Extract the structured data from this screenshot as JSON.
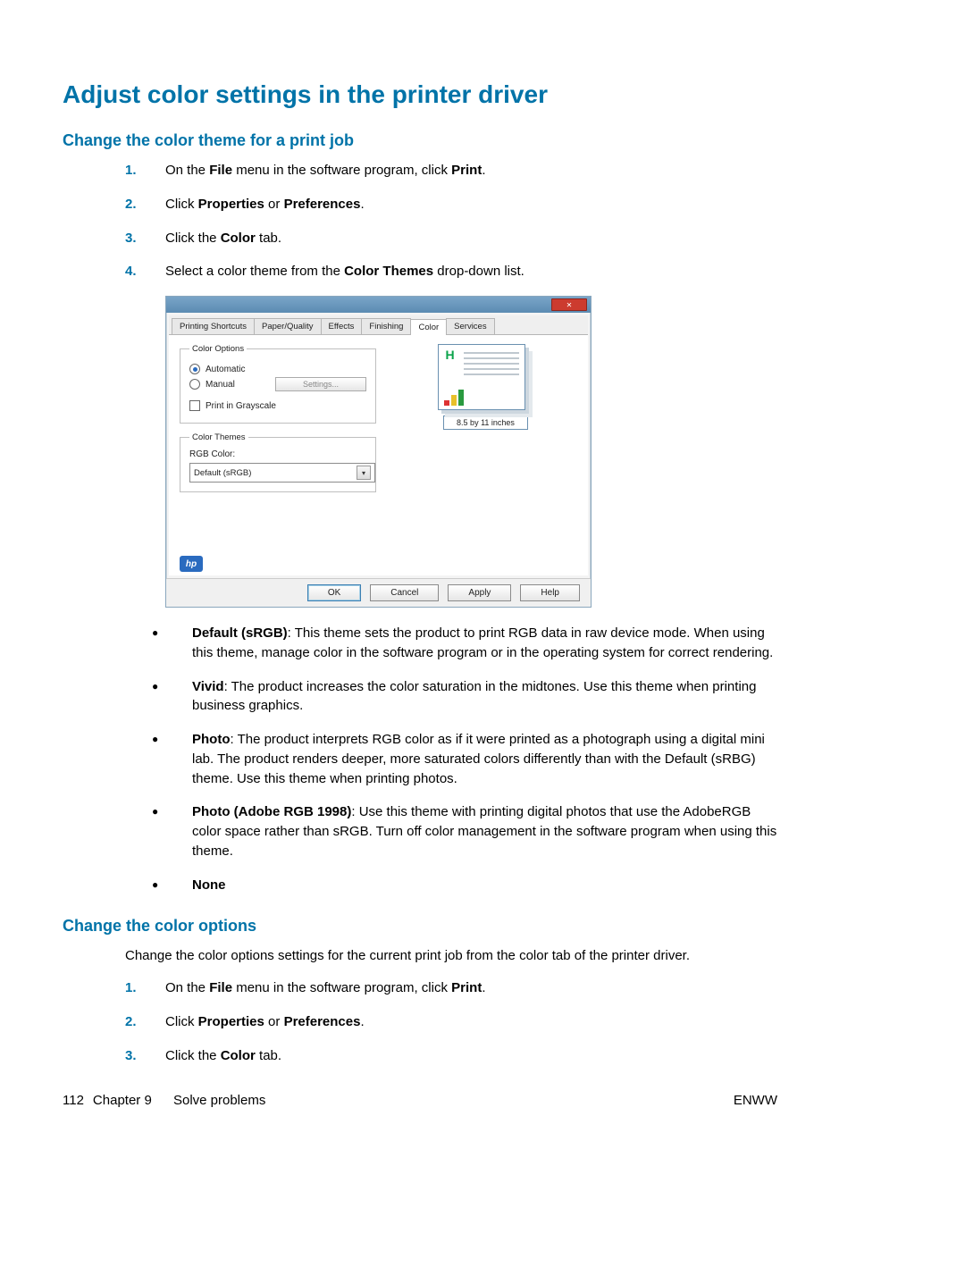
{
  "heading_main": "Adjust color settings in the printer driver",
  "section_a": {
    "heading": "Change the color theme for a print job",
    "steps": [
      {
        "pre": "On the ",
        "b1": "File",
        "mid": " menu in the software program, click ",
        "b2": "Print",
        "post": "."
      },
      {
        "pre": "Click ",
        "b1": "Properties",
        "mid": " or ",
        "b2": "Preferences",
        "post": "."
      },
      {
        "pre": "Click the ",
        "b1": "Color",
        "mid": " tab.",
        "b2": "",
        "post": ""
      },
      {
        "pre": "Select a color theme from the ",
        "b1": "Color Themes",
        "mid": " drop-down list.",
        "b2": "",
        "post": ""
      }
    ],
    "bullets": [
      {
        "b": "Default (sRGB)",
        "t": ": This theme sets the product to print RGB data in raw device mode. When using this theme, manage color in the software program or in the operating system for correct rendering."
      },
      {
        "b": "Vivid",
        "t": ": The product increases the color saturation in the midtones. Use this theme when printing business graphics."
      },
      {
        "b": "Photo",
        "t": ": The product interprets RGB color as if it were printed as a photograph using a digital mini lab. The product renders deeper, more saturated colors differently than with the Default (sRBG) theme. Use this theme when printing photos."
      },
      {
        "b": "Photo (Adobe RGB 1998)",
        "t": ": Use this theme with printing digital photos that use the AdobeRGB color space rather than sRGB. Turn off color management in the software program when using this theme."
      },
      {
        "b": "None",
        "t": ""
      }
    ]
  },
  "section_b": {
    "heading": "Change the color options",
    "intro": "Change the color options settings for the current print job from the color tab of the printer driver.",
    "steps": [
      {
        "pre": "On the ",
        "b1": "File",
        "mid": " menu in the software program, click ",
        "b2": "Print",
        "post": "."
      },
      {
        "pre": "Click ",
        "b1": "Properties",
        "mid": " or ",
        "b2": "Preferences",
        "post": "."
      },
      {
        "pre": "Click the ",
        "b1": "Color",
        "mid": " tab.",
        "b2": "",
        "post": ""
      }
    ]
  },
  "dialog": {
    "title_hint": "",
    "tabs": [
      "Printing Shortcuts",
      "Paper/Quality",
      "Effects",
      "Finishing",
      "Color",
      "Services"
    ],
    "active_tab": "Color",
    "color_options": {
      "legend": "Color Options",
      "automatic": "Automatic",
      "manual": "Manual",
      "settings_btn": "Settings...",
      "grayscale": "Print in Grayscale"
    },
    "color_themes": {
      "legend": "Color Themes",
      "rgb_label": "RGB Color:",
      "selected": "Default (sRGB)"
    },
    "preview_dims": "8.5 by 11 inches",
    "hp_glyph": "hp",
    "h_glyph": "H",
    "buttons": {
      "ok": "OK",
      "cancel": "Cancel",
      "apply": "Apply",
      "help": "Help"
    }
  },
  "footer": {
    "page": "112",
    "chapter_label": "Chapter 9",
    "chapter_title": "Solve problems",
    "right": "ENWW"
  }
}
